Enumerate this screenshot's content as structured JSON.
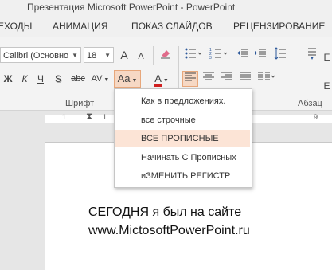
{
  "window": {
    "title": "Презентация Microsoft PowerPoint - PowerPoint"
  },
  "tabs": [
    "ЕХОДЫ",
    "АНИМАЦИЯ",
    "ПОКАЗ СЛАЙДОВ",
    "РЕЦЕНЗИРОВАНИЕ"
  ],
  "ribbon": {
    "font_name": "Calibri (Основно",
    "font_size": "18",
    "grow_font": "A",
    "shrink_font": "A",
    "bold": "Ж",
    "italic": "К",
    "underline": "Ч",
    "shadow": "S",
    "strikethrough": "abc",
    "spacing": "AV",
    "change_case": "Aa",
    "font_color": "A",
    "font_group_label": "Шрифт",
    "paragraph_group_label": "Абзац",
    "edge_letter_1": "Е",
    "edge_letter_2": "Е"
  },
  "ruler": {
    "marks": [
      "1",
      "1",
      "2",
      "9"
    ]
  },
  "change_case_menu": {
    "items": [
      {
        "label": "Как в предложениях.",
        "highlighted": false
      },
      {
        "label": "все строчные",
        "highlighted": false
      },
      {
        "label": "ВСЕ ПРОПИСНЫЕ",
        "highlighted": true
      },
      {
        "label": "Начинать С Прописных",
        "highlighted": false
      },
      {
        "label": "иЗМЕНИТЬ РЕГИСТР",
        "highlighted": false
      }
    ]
  },
  "slide": {
    "line1": "СЕГОДНЯ я был на сайте",
    "line2": "www.MictosoftPowerPoint.ru"
  },
  "colors": {
    "accent": "#d24726",
    "highlight": "#fce4d6",
    "selected_button": "#f6d8c4"
  }
}
